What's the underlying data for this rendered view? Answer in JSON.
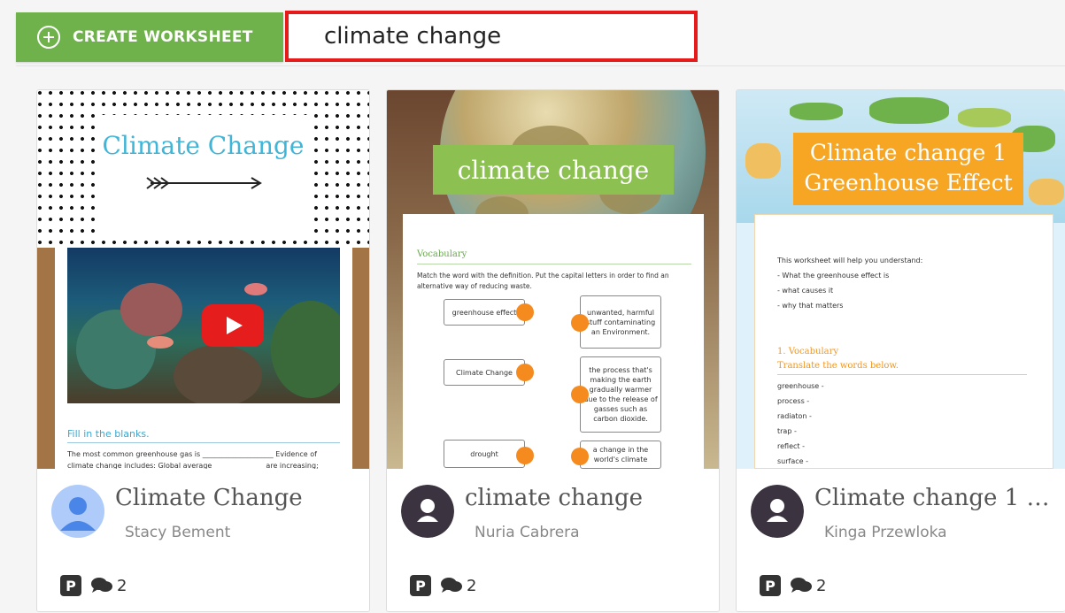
{
  "toolbar": {
    "create_label": "CREATE WORKSHEET",
    "search_value": "climate change",
    "accent_color": "#6fb24b",
    "highlight_color": "#e61a1a"
  },
  "cards": [
    {
      "title": "Climate Change",
      "author": "Stacy Bement",
      "comments": "2",
      "thumb": {
        "title": "Climate Change",
        "section": "Fill in the blanks.",
        "text_a": "The most common greenhouse gas is",
        "text_b": "Evidence of",
        "text_c": "climate change includes: Global average",
        "text_d": "are increasing;"
      },
      "avatar_icon": "user-avatar-icon"
    },
    {
      "title": "climate change",
      "author": "Nuria Cabrera",
      "comments": "2",
      "thumb": {
        "banner": "climate change",
        "heading": "Vocabulary",
        "instruction": "Match the word with the definition. Put the capital letters in order to find an alternative way of reducing waste.",
        "words": [
          "greenhouse effect",
          "Climate Change",
          "drought"
        ],
        "definitions": [
          "unwanted, harmful stuff contaminating an Environment.",
          "the process that's making the earth gradually warmer due to the release of gasses such as carbon dioxide.",
          "a change in the world's climate"
        ]
      },
      "avatar_icon": "user-silhouette-icon"
    },
    {
      "title": "Climate change 1 Gr...",
      "author": "Kinga Przewloka",
      "comments": "2",
      "thumb": {
        "banner_line1": "Climate change 1",
        "banner_line2": "Greenhouse Effect",
        "intro": [
          "This worksheet will help you understand:",
          "- What the greenhouse effect is",
          "- what causes it",
          "- why that matters"
        ],
        "section_title": "1. Vocabulary",
        "section_sub": "Translate the words below.",
        "words": [
          "greenhouse -",
          "process -",
          "radiaton -",
          "trap -",
          "reflect -",
          "surface -"
        ]
      },
      "avatar_icon": "user-silhouette-icon"
    }
  ]
}
